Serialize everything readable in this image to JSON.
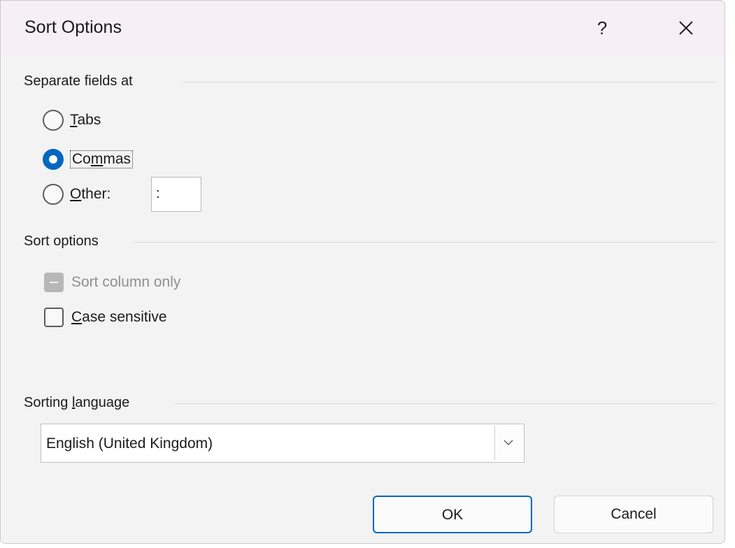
{
  "dialog": {
    "title": "Sort Options",
    "help_label": "?",
    "close_icon": "close-icon"
  },
  "separate_fields": {
    "heading": "Separate fields at",
    "options": [
      {
        "label_pre": "",
        "accel": "T",
        "label_post": "abs",
        "checked": false
      },
      {
        "label_pre": "Co",
        "accel": "m",
        "label_post": "mas",
        "checked": true
      },
      {
        "label_pre": "",
        "accel": "O",
        "label_post": "ther:",
        "checked": false
      }
    ],
    "other_value": ":"
  },
  "sort_options": {
    "heading": "Sort options",
    "sort_column_only": {
      "label": "Sort column only",
      "state": "indeterminate",
      "disabled": true
    },
    "case_sensitive": {
      "accel": "C",
      "label_post": "ase sensitive",
      "checked": false
    }
  },
  "sorting_language": {
    "heading_pre": "Sorting ",
    "heading_accel": "l",
    "heading_post": "anguage",
    "selected": "English (United Kingdom)"
  },
  "buttons": {
    "ok": "OK",
    "cancel": "Cancel"
  },
  "colors": {
    "accent": "#0067c0",
    "titlebar": "#f6eff6",
    "body": "#f3f3f3"
  }
}
